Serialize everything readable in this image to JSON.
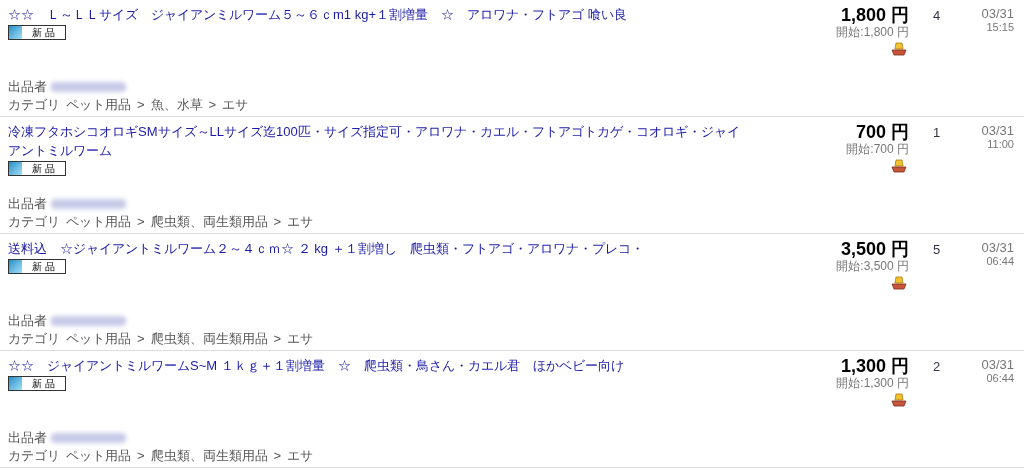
{
  "listings": [
    {
      "title": "☆☆　Ｌ～ＬＬサイズ　ジャイアンミルワーム５～６ｃm1 kg+１割増量　☆　アロワナ・フトアゴ 喰い良",
      "badge": "新 品",
      "seller_label": "出品者",
      "category_label": "カテゴリ",
      "separator": ">",
      "categories": [
        "ペット用品",
        "魚、水草",
        "エサ"
      ],
      "price": "1,800 円",
      "start_price": "開始:1,800 円",
      "bids": "4",
      "date": "03/31",
      "time": "15:15"
    },
    {
      "title": "冷凍フタホシコオロギSMサイズ～LLサイズ迄100匹・サイズ指定可・アロワナ・カエル・フトアゴトカゲ・コオロギ・ジャイアントミルワーム",
      "badge": "新 品",
      "seller_label": "出品者",
      "category_label": "カテゴリ",
      "separator": ">",
      "categories": [
        "ペット用品",
        "爬虫類、両生類用品",
        "エサ"
      ],
      "price": "700 円",
      "start_price": "開始:700 円",
      "bids": "1",
      "date": "03/31",
      "time": "11:00"
    },
    {
      "title": "送料込　☆ジャイアントミルワーム２～４ｃｍ☆ ２ kg ＋１割増し　爬虫類・フトアゴ・アロワナ・プレコ・",
      "badge": "新 品",
      "seller_label": "出品者",
      "category_label": "カテゴリ",
      "separator": ">",
      "categories": [
        "ペット用品",
        "爬虫類、両生類用品",
        "エサ"
      ],
      "price": "3,500 円",
      "start_price": "開始:3,500 円",
      "bids": "5",
      "date": "03/31",
      "time": "06:44"
    },
    {
      "title": "☆☆　ジャイアントミルワームS~M １ｋｇ＋１割増量　☆　爬虫類・鳥さん・カエル君　ほかベビー向け",
      "badge": "新 品",
      "seller_label": "出品者",
      "category_label": "カテゴリ",
      "separator": ">",
      "categories": [
        "ペット用品",
        "爬虫類、両生類用品",
        "エサ"
      ],
      "price": "1,300 円",
      "start_price": "開始:1,300 円",
      "bids": "2",
      "date": "03/31",
      "time": "06:44"
    }
  ]
}
